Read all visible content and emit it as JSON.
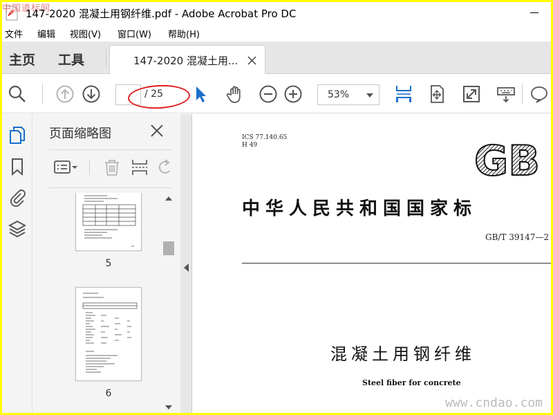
{
  "window": {
    "title": "147-2020 混凝土用钢纤维.pdf - Adobe Acrobat Pro DC",
    "corner_watermark": "中国道标网"
  },
  "menu": [
    "文件",
    "编辑",
    "视图(V)",
    "窗口(W)",
    "帮助(H)"
  ],
  "nav_tabs": {
    "home": "主页",
    "tools": "工具"
  },
  "doc_tab": {
    "label": "147-2020 混凝土用..."
  },
  "toolbar": {
    "page_current": "",
    "page_total": "/ 25",
    "zoom": "53%"
  },
  "panel": {
    "title": "页面缩略图",
    "thumbnails": [
      {
        "label": "5"
      },
      {
        "label": "6"
      }
    ]
  },
  "document": {
    "ics": "ICS  77.140.65",
    "h": "H  49",
    "logo_text": "GB",
    "national_standard": "中华人民共和国国家标",
    "standard_number": "GB/T  39147—2",
    "title_cn": "混凝土用钢纤维",
    "title_en": "Steel fiber for concrete",
    "watermark": "www.cndao.com"
  },
  "colors": {
    "border": "#ffff00",
    "accent_blue": "#1a6fc9",
    "annotation_red": "#e02020"
  }
}
